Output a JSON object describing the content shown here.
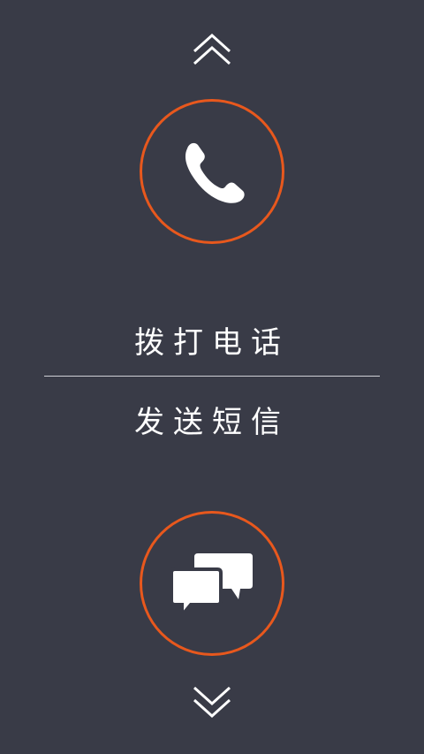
{
  "colors": {
    "background": "#393b47",
    "accent_ring": "#e8581d",
    "text": "#ffffff",
    "divider": "#cfd0d6"
  },
  "nav": {
    "up_icon": "double-chevron-up-icon",
    "down_icon": "double-chevron-down-icon"
  },
  "call": {
    "icon": "phone-icon",
    "label": "拨打电话"
  },
  "sms": {
    "icon": "chat-bubbles-icon",
    "label": "发送短信"
  }
}
